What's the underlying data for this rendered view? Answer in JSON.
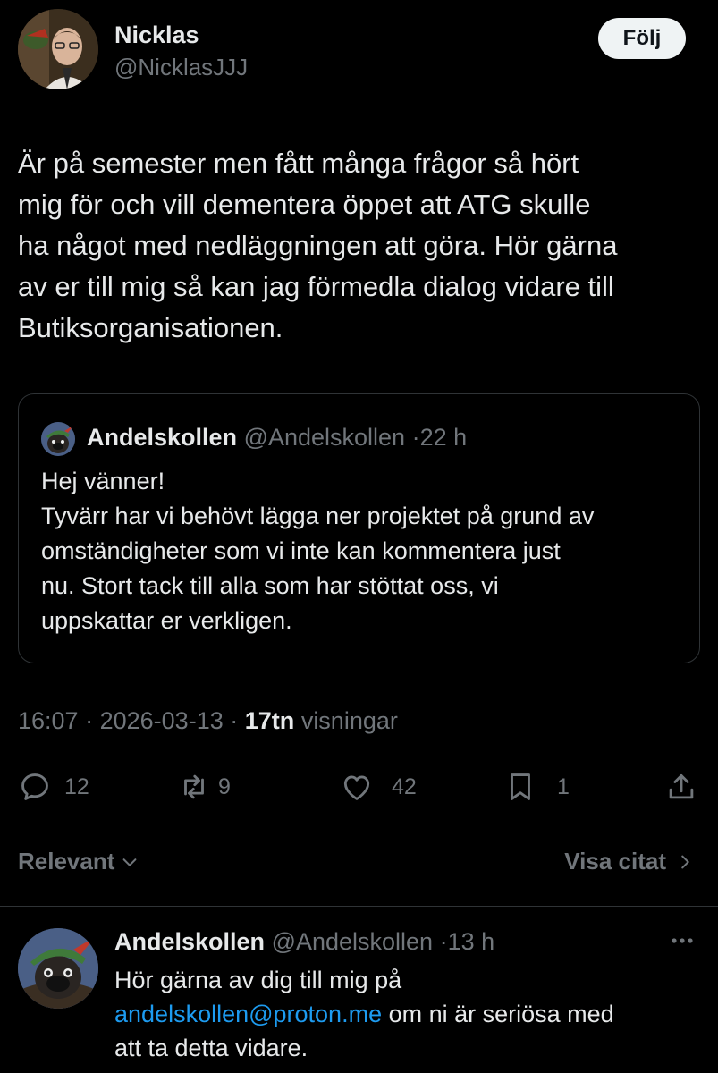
{
  "author": {
    "name": "Nicklas",
    "handle": "@NicklasJJJ",
    "follow_label": "Följ"
  },
  "tweet": {
    "lines": [
      "Är på semester men fått många frågor så hört",
      "mig för och vill dementera öppet att ATG skulle",
      "ha något med nedläggningen att göra. Hör gärna",
      "av er till mig så kan jag förmedla dialog vidare till",
      "Butiksorganisationen."
    ]
  },
  "quote": {
    "name": "Andelskollen",
    "handle": "@Andelskollen",
    "separator": "·",
    "time": "22 h",
    "lines": [
      "Hej vänner!",
      "Tyvärr har vi behövt lägga ner projektet på grund av",
      "omständigheter som vi inte kan kommentera just",
      "nu. Stort tack till alla som har stöttat oss, vi",
      "uppskattar er verkligen."
    ]
  },
  "meta": {
    "time": "16:07",
    "sep1": "·",
    "date": "2026-03-13",
    "sep2": "·",
    "views_count": "17tn",
    "views_label": "visningar"
  },
  "actions": {
    "replies": "12",
    "retweets": "9",
    "likes": "42",
    "bookmarks": "1"
  },
  "sort": {
    "relevant_label": "Relevant",
    "view_quotes_label": "Visa citat"
  },
  "reply": {
    "name": "Andelskollen",
    "handle": "@Andelskollen",
    "separator": "·",
    "time": "13 h",
    "line1": "Hör gärna av dig till mig på",
    "email": "andelskollen@proton.me",
    "line2_rest": " om ni är seriösa med",
    "line3": "att ta detta vidare."
  },
  "colors": {
    "background": "#000000",
    "text": "#e7e9ea",
    "muted": "#71767b",
    "link": "#1d9bf0",
    "border": "#2f3336"
  },
  "icons": [
    "reply-icon",
    "retweet-icon",
    "heart-icon",
    "bookmark-icon",
    "share-icon",
    "chevron-down-icon",
    "chevron-right-icon",
    "more-icon"
  ]
}
